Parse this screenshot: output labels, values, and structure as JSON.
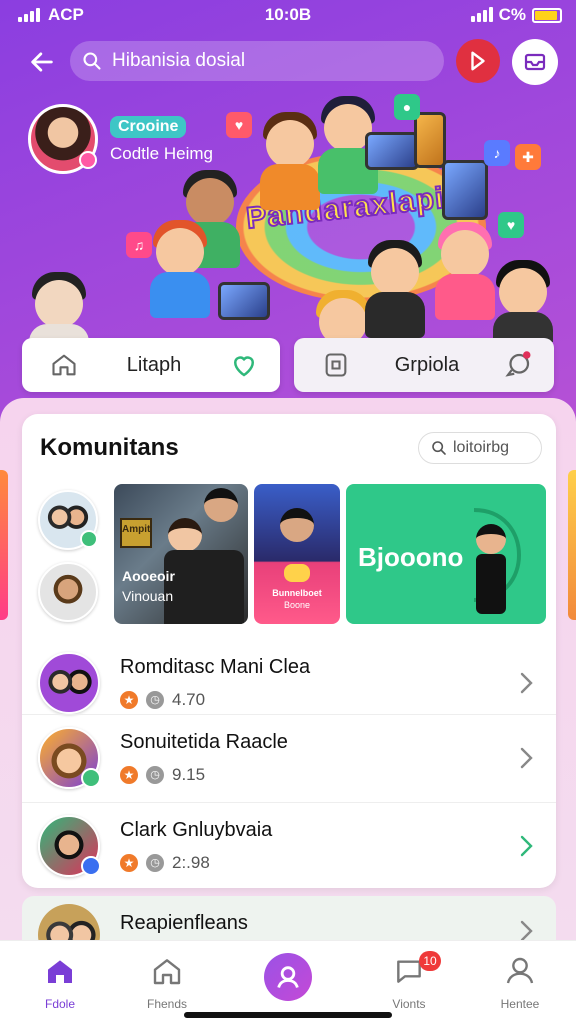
{
  "status_bar": {
    "carrier": "ACP",
    "time": "10:0B",
    "battery_text": "C%"
  },
  "topbar": {
    "search_text": "Hibanisia dosial"
  },
  "hero": {
    "badge": "Crooine",
    "subtitle": "Codtle Heimg",
    "title": "Pandaraxlapi"
  },
  "tabs": [
    {
      "label": "Litaph"
    },
    {
      "label": "Grpiola"
    }
  ],
  "community": {
    "title": "Komunitans",
    "search_placeholder": "loitoirbg",
    "tiles": [
      {
        "badge": "Ampit",
        "caption_line1": "Aooeoir",
        "caption_line2": "Vinouan"
      },
      {
        "caption_line1": "Bunnelboet",
        "caption_line2": "Boone"
      },
      {
        "caption": "Bjooono"
      }
    ],
    "rows": [
      {
        "name": "Romditasc Mani Clea",
        "rating": "4.70"
      },
      {
        "name": "Sonuitetida Raacle",
        "rating": "9.15"
      },
      {
        "name": "Clark Gnluybvaia",
        "rating": "2:.98"
      },
      {
        "name": "Reapienfleans",
        "rating": ""
      }
    ]
  },
  "bottom_nav": {
    "items": [
      {
        "label": "Fdole",
        "active": true
      },
      {
        "label": "Fhends"
      },
      {
        "label": ""
      },
      {
        "label": "Vionts",
        "badge": "10"
      },
      {
        "label": "Hentee"
      }
    ]
  },
  "colors": {
    "accent": "#8b3ee0",
    "tile_green": "#2fc889",
    "star": "#f07a2a",
    "notif": "#ef3a3a"
  }
}
